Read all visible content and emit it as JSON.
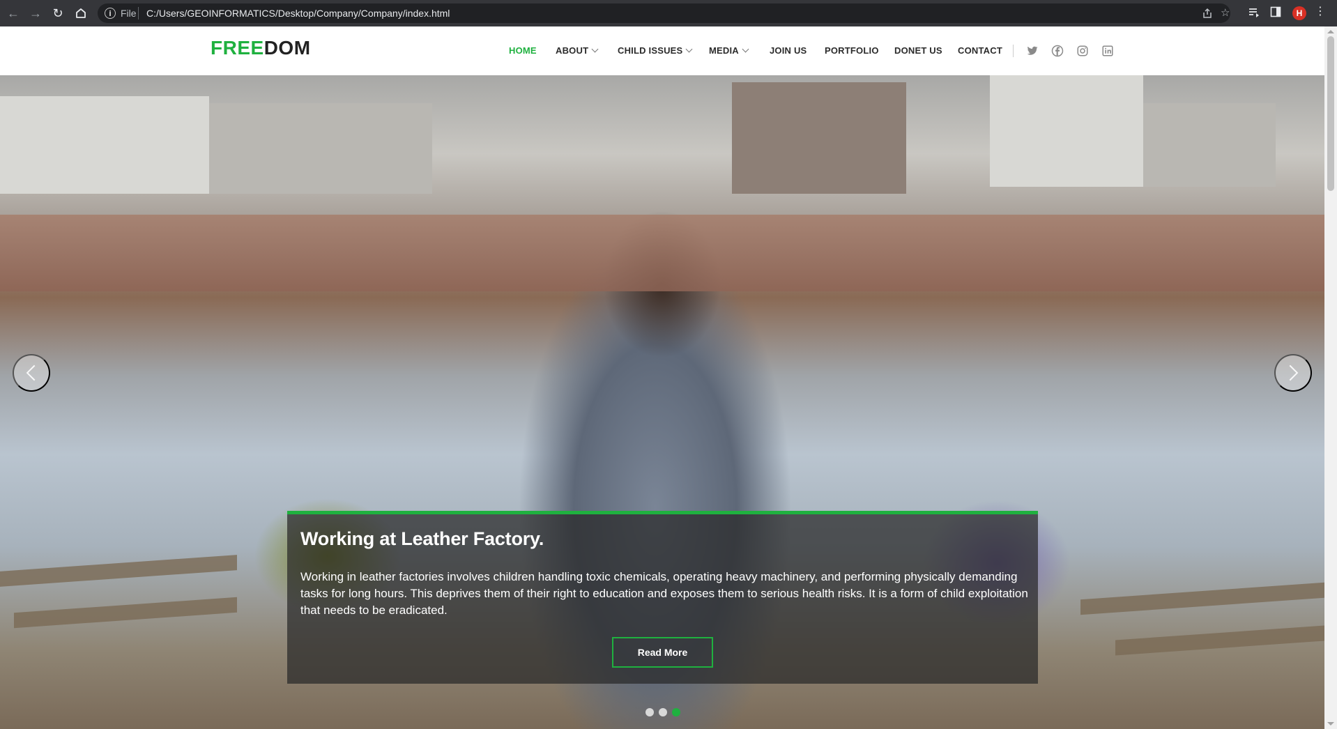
{
  "browser": {
    "scheme_label": "File",
    "url": "C:/Users/GEOINFORMATICS/Desktop/Company/Company/index.html",
    "profile_initial": "H",
    "icons": [
      "back-arrow-icon",
      "forward-arrow-icon",
      "reload-icon",
      "home-icon",
      "info-icon",
      "share-icon",
      "star-icon",
      "reading-list-icon",
      "side-panel-icon",
      "kebab-menu-icon"
    ]
  },
  "site": {
    "logo_part1": "FREE",
    "logo_part2": "DOM",
    "nav": [
      {
        "label": "HOME",
        "active": true
      },
      {
        "label": "ABOUT",
        "dropdown": true
      },
      {
        "label": "CHILD ISSUES",
        "dropdown": true
      },
      {
        "label": "MEDIA",
        "dropdown": true
      },
      {
        "label": "JOIN US"
      },
      {
        "label": "PORTFOLIO"
      },
      {
        "label": "DONET US"
      },
      {
        "label": "CONTACT"
      }
    ],
    "social_icons": [
      "twitter-icon",
      "facebook-icon",
      "instagram-icon",
      "linkedin-icon"
    ]
  },
  "hero": {
    "title": "Working at Leather Factory.",
    "description": "Working in leather factories involves children handling toxic chemicals, operating heavy machinery, and performing physically demanding tasks for long hours. This deprives them of their right to education and exposes them to serious health risks. It is a form of child exploitation that needs to be eradicated.",
    "button_label": "Read More",
    "slide_count": 3,
    "active_slide": 3
  },
  "colors": {
    "accent": "#1fb13f",
    "chrome_bg": "#35363a",
    "omnibox_bg": "#202124",
    "caption_bg": "rgba(40,40,40,0.72)"
  }
}
